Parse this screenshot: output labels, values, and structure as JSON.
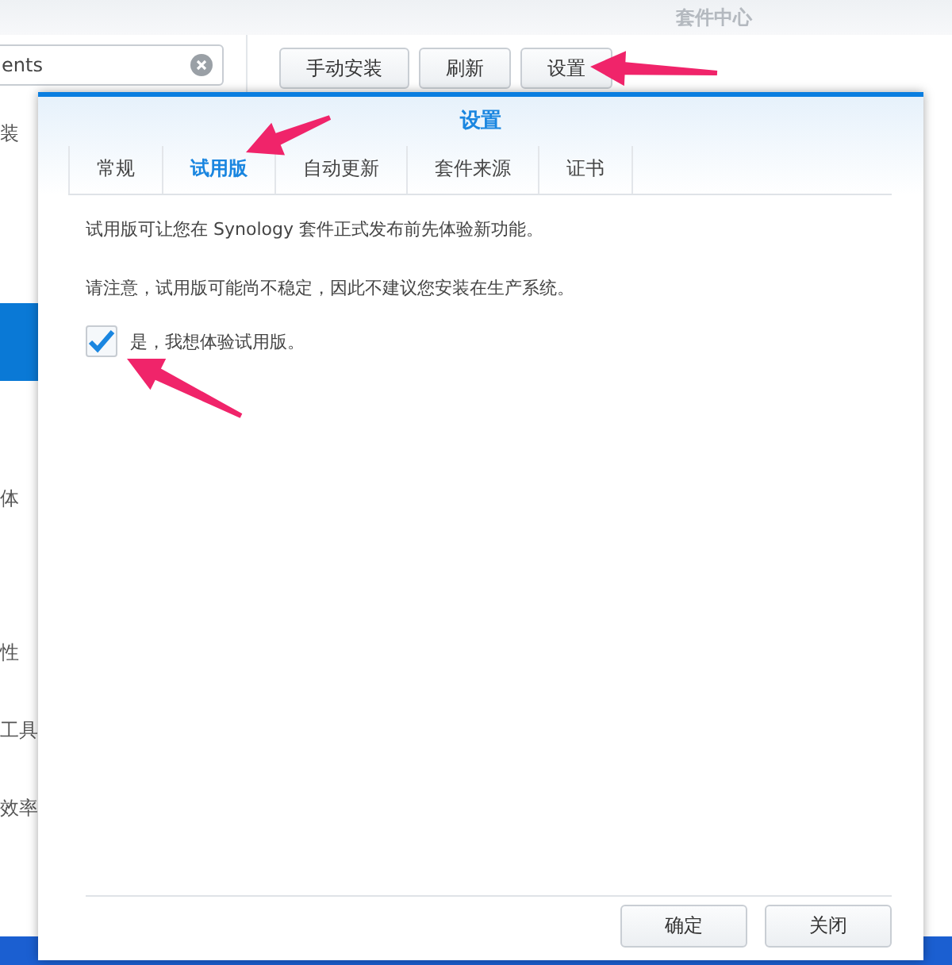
{
  "app": {
    "title": "套件中心",
    "search": {
      "value": "ents"
    },
    "sidebar": {
      "items": [
        {
          "label": "装",
          "selected": false
        },
        {
          "selected": true
        },
        {
          "label": "体",
          "selected": false
        },
        {
          "label": "性",
          "selected": false
        },
        {
          "label": "工具",
          "selected": false
        },
        {
          "label": "效率",
          "selected": false
        }
      ]
    },
    "toolbar": [
      "手动安装",
      "刷新",
      "设置"
    ]
  },
  "dialog": {
    "title": "设置",
    "tabs": [
      {
        "label": "常规",
        "selected": false
      },
      {
        "label": "试用版",
        "selected": true
      },
      {
        "label": "自动更新",
        "selected": false
      },
      {
        "label": "套件来源",
        "selected": false
      },
      {
        "label": "证书",
        "selected": false
      }
    ],
    "paragraphs": [
      "试用版可让您在 Synology 套件正式发布前先体验新功能。",
      "请注意，试用版可能尚不稳定，因此不建议您安装在生产系统。"
    ],
    "checkbox": {
      "label": "是，我想体验试用版。",
      "checked": true
    },
    "buttons": [
      "确定",
      "关闭"
    ]
  }
}
